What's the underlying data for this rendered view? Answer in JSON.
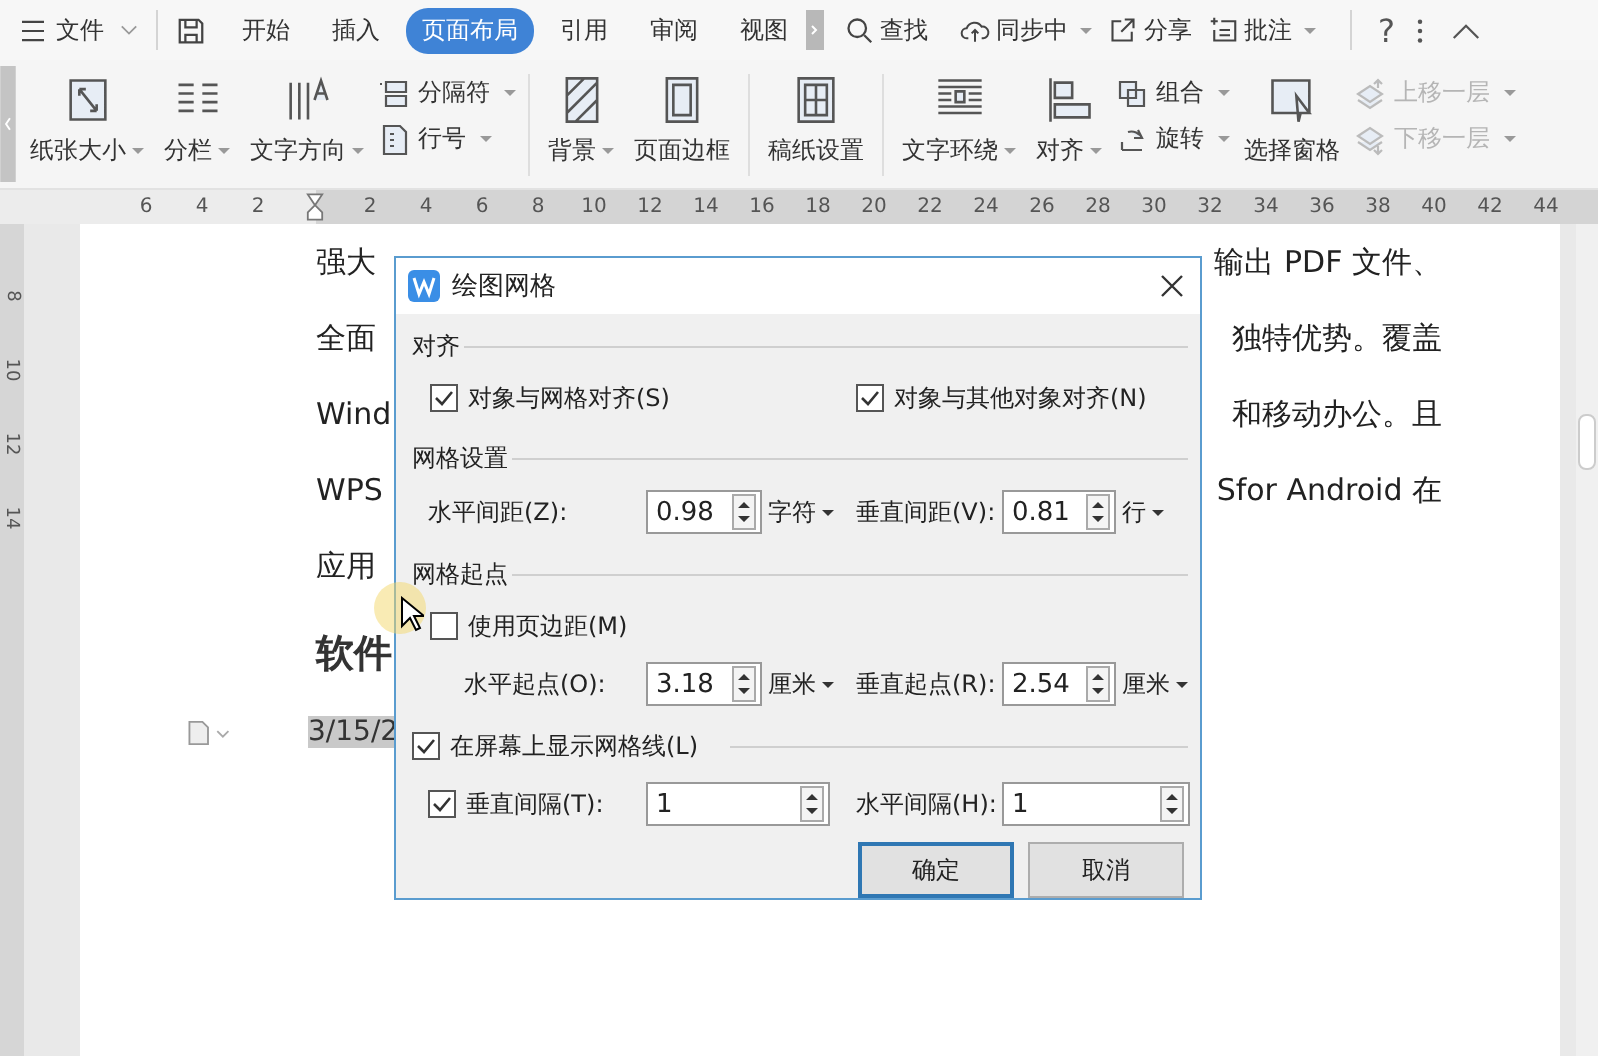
{
  "menu_bar": {
    "file_menu": "文件",
    "tabs": [
      {
        "label": "开始",
        "selected": false
      },
      {
        "label": "插入",
        "selected": false
      },
      {
        "label": "页面布局",
        "selected": true
      },
      {
        "label": "引用",
        "selected": false
      },
      {
        "label": "审阅",
        "selected": false
      },
      {
        "label": "视图",
        "selected": false
      }
    ],
    "find": "查找",
    "sync": "同步中",
    "share": "分享",
    "comment": "批注",
    "help": "?"
  },
  "ribbon": {
    "groups": [
      {
        "items": [
          {
            "kind": "large",
            "label": "纸张大小",
            "dropdown": true
          },
          {
            "kind": "large",
            "label": "分栏",
            "dropdown": true
          },
          {
            "kind": "large",
            "label": "文字方向",
            "dropdown": true
          },
          {
            "kind": "stack",
            "items": [
              {
                "label": "分隔符",
                "dropdown": true,
                "disabled": false
              },
              {
                "label": "行号",
                "dropdown": true,
                "disabled": false
              }
            ]
          }
        ]
      },
      {
        "items": [
          {
            "kind": "large",
            "label": "背景",
            "dropdown": true
          },
          {
            "kind": "large",
            "label": "页面边框",
            "dropdown": false
          }
        ]
      },
      {
        "items": [
          {
            "kind": "large",
            "label": "稿纸设置",
            "dropdown": false
          }
        ]
      },
      {
        "items": [
          {
            "kind": "large",
            "label": "文字环绕",
            "dropdown": true
          },
          {
            "kind": "large",
            "label": "对齐",
            "dropdown": true
          },
          {
            "kind": "stack",
            "items": [
              {
                "label": "组合",
                "dropdown": true,
                "disabled": false
              },
              {
                "label": "旋转",
                "dropdown": true,
                "disabled": false
              }
            ]
          },
          {
            "kind": "large",
            "label": "选择窗格",
            "dropdown": false
          },
          {
            "kind": "stack",
            "items": [
              {
                "label": "上移一层",
                "dropdown": true,
                "disabled": true
              },
              {
                "label": "下移一层",
                "dropdown": true,
                "disabled": true
              }
            ]
          }
        ]
      }
    ]
  },
  "ruler": {
    "left_numbers": [
      "6",
      "4",
      "2"
    ],
    "numbers": [
      "2",
      "4",
      "6",
      "8",
      "10",
      "12",
      "14",
      "16",
      "18",
      "20",
      "22",
      "24",
      "26",
      "28",
      "30",
      "32",
      "34",
      "36",
      "38",
      "40",
      "42",
      "44"
    ],
    "vertical_numbers": [
      "8",
      "10",
      "12",
      "14"
    ]
  },
  "document": {
    "lines": [
      {
        "left": "强大",
        "right": "输出 PDF 文件、"
      },
      {
        "left": "全面",
        "right": "独特优势。覆盖"
      },
      {
        "left": "Wind",
        "right": "和移动办公。且"
      },
      {
        "left": "WPS",
        "right": "Sfor Android 在"
      },
      {
        "left": "应用"
      }
    ],
    "heading": "软件",
    "date": "3/15/2"
  },
  "dialog": {
    "title": "绘图网格",
    "align_section": "对齐",
    "align_options": [
      {
        "label": "对象与网格对齐(S)",
        "checked": true
      },
      {
        "label": "对象与其他对象对齐(N)",
        "checked": true
      }
    ],
    "grid_section": "网格设置",
    "spacing": [
      {
        "label": "水平间距(Z):",
        "value": "0.98",
        "unit": "字符"
      },
      {
        "label": "垂直间距(V):",
        "value": "0.81",
        "unit": "行"
      }
    ],
    "origin_section": "网格起点",
    "use_margins": {
      "label": "使用页边距(M)",
      "checked": false
    },
    "origin": [
      {
        "label": "水平起点(O):",
        "value": "3.18",
        "unit": "厘米"
      },
      {
        "label": "垂直起点(R):",
        "value": "2.54",
        "unit": "厘米"
      }
    ],
    "show_grid": {
      "label": "在屏幕上显示网格线(L)",
      "checked": true
    },
    "vertical_interval": {
      "label": "垂直间隔(T):",
      "checked": true,
      "value": "1"
    },
    "horizontal_interval": {
      "label": "水平间隔(H):",
      "value": "1"
    },
    "buttons": [
      {
        "label": "确定",
        "default": true
      },
      {
        "label": "取消",
        "default": false
      }
    ]
  }
}
